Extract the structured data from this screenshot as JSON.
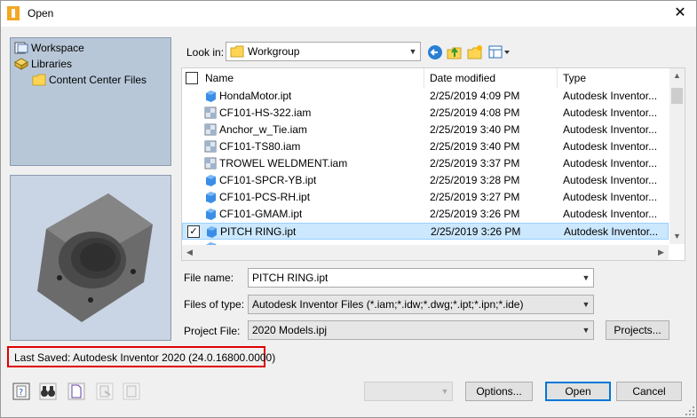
{
  "window": {
    "title": "Open",
    "close_glyph": "✕"
  },
  "locations": [
    {
      "label": "Workspace",
      "icon": "workspace-icon"
    },
    {
      "label": "Libraries",
      "icon": "libraries-icon"
    },
    {
      "label": "Content Center Files",
      "icon": "folder-icon"
    }
  ],
  "look_in": {
    "label": "Look in:",
    "value": "Workgroup"
  },
  "toolbar": {
    "icons": [
      "back-icon",
      "up-folder-icon",
      "new-folder-icon",
      "view-menu-icon"
    ]
  },
  "columns": {
    "name": "Name",
    "date": "Date modified",
    "type": "Type"
  },
  "files": [
    {
      "name": "HondaMotor.ipt",
      "date": "2/25/2019 4:09 PM",
      "type": "Autodesk Inventor...",
      "kind": "part"
    },
    {
      "name": "CF101-HS-322.iam",
      "date": "2/25/2019 4:08 PM",
      "type": "Autodesk Inventor...",
      "kind": "assembly"
    },
    {
      "name": "Anchor_w_Tie.iam",
      "date": "2/25/2019 3:40 PM",
      "type": "Autodesk Inventor...",
      "kind": "assembly"
    },
    {
      "name": "CF101-TS80.iam",
      "date": "2/25/2019 3:40 PM",
      "type": "Autodesk Inventor...",
      "kind": "assembly"
    },
    {
      "name": "TROWEL WELDMENT.iam",
      "date": "2/25/2019 3:37 PM",
      "type": "Autodesk Inventor...",
      "kind": "assembly"
    },
    {
      "name": "CF101-SPCR-YB.ipt",
      "date": "2/25/2019 3:28 PM",
      "type": "Autodesk Inventor...",
      "kind": "part"
    },
    {
      "name": "CF101-PCS-RH.ipt",
      "date": "2/25/2019 3:27 PM",
      "type": "Autodesk Inventor...",
      "kind": "part"
    },
    {
      "name": "CF101-GMAM.ipt",
      "date": "2/25/2019 3:26 PM",
      "type": "Autodesk Inventor...",
      "kind": "part"
    },
    {
      "name": "PITCH RING.ipt",
      "date": "2/25/2019 3:26 PM",
      "type": "Autodesk Inventor...",
      "kind": "part",
      "selected": true
    },
    {
      "name": "",
      "date": "",
      "type": "",
      "kind": "part"
    }
  ],
  "fields": {
    "file_name": {
      "label": "File name:",
      "value": "PITCH RING.ipt"
    },
    "files_of_type": {
      "label": "Files of type:",
      "value": "Autodesk Inventor Files (*.iam;*.idw;*.dwg;*.ipt;*.ipn;*.ide)"
    },
    "project_file": {
      "label": "Project File:",
      "value": "2020 Models.ipj"
    }
  },
  "buttons": {
    "projects": "Projects...",
    "options": "Options...",
    "open": "Open",
    "cancel": "Cancel"
  },
  "status": {
    "last_saved": "Last Saved: Autodesk Inventor 2020 (24.0.16800.0000)"
  },
  "colors": {
    "selection": "#cce8ff",
    "highlight_box": "#e00000",
    "left_panel": "#b8c7d8",
    "part_icon": "#3a8ee6"
  }
}
